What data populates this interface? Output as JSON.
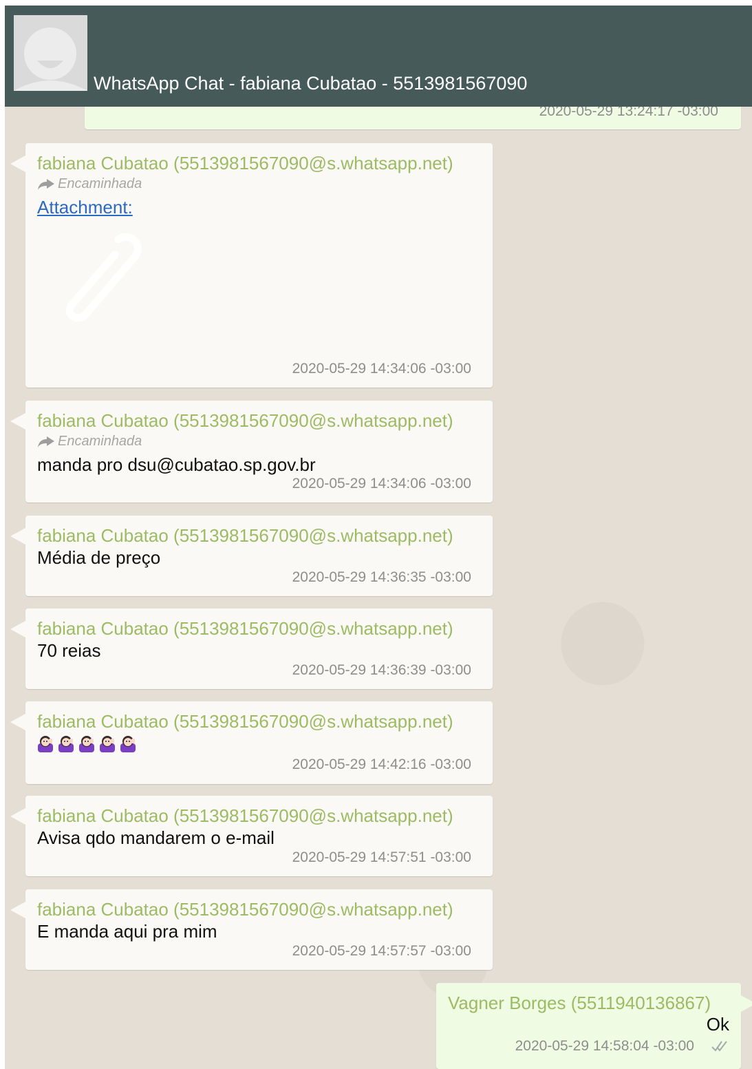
{
  "header": {
    "title": "WhatsApp Chat - fabiana Cubatao - 5513981567090"
  },
  "top_partial": {
    "time": "2020-05-29 13:24:17 -03:00"
  },
  "messages": [
    {
      "sender": "fabiana Cubatao (5513981567090@s.whatsapp.net)",
      "forwarded_label": "Encaminhada",
      "link_text": "Attachment:",
      "time": "2020-05-29 14:34:06 -03:00"
    },
    {
      "sender": "fabiana Cubatao (5513981567090@s.whatsapp.net)",
      "forwarded_label": "Encaminhada",
      "text": "manda pro dsu@cubatao.sp.gov.br",
      "time": "2020-05-29 14:34:06 -03:00"
    },
    {
      "sender": "fabiana Cubatao (5513981567090@s.whatsapp.net)",
      "text": "Média de preço",
      "time": "2020-05-29 14:36:35 -03:00"
    },
    {
      "sender": "fabiana Cubatao (5513981567090@s.whatsapp.net)",
      "text": "70 reias",
      "time": "2020-05-29 14:36:39 -03:00"
    },
    {
      "sender": "fabiana Cubatao (5513981567090@s.whatsapp.net)",
      "emoji_count": 5,
      "time": "2020-05-29 14:42:16 -03:00"
    },
    {
      "sender": "fabiana Cubatao (5513981567090@s.whatsapp.net)",
      "text": "Avisa qdo mandarem o e-mail",
      "time": "2020-05-29 14:57:51 -03:00"
    },
    {
      "sender": "fabiana Cubatao (5513981567090@s.whatsapp.net)",
      "text": "E manda aqui pra mim",
      "time": "2020-05-29 14:57:57 -03:00"
    },
    {
      "sender": "Vagner Borges (5511940136867)",
      "text": "Ok",
      "time": "2020-05-29 14:58:04 -03:00",
      "status": "delivered"
    }
  ],
  "colors": {
    "header_bg": "#455a59",
    "sender_name": "#9cbb63",
    "incoming_bubble": "#fbf9f5",
    "outgoing_bubble": "#effbe3",
    "link": "#2a6ac5"
  },
  "icons": [
    "avatar-icon",
    "forward-icon",
    "paperclip-icon",
    "woman-tipping-hand-icon",
    "double-check-icon"
  ]
}
